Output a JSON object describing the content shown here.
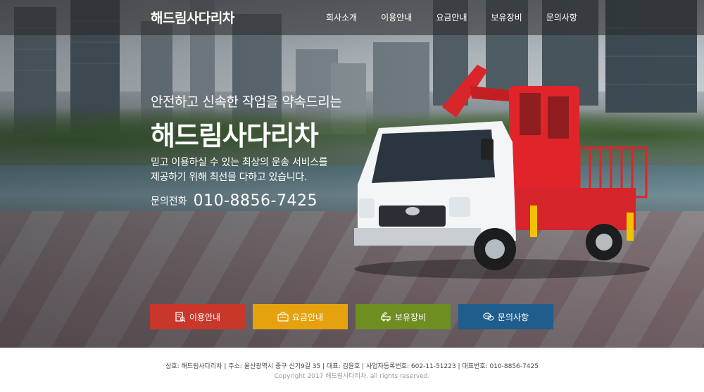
{
  "header": {
    "logo": "해드림사다리차",
    "nav": [
      {
        "label": "회사소개"
      },
      {
        "label": "이용안내"
      },
      {
        "label": "요금안내"
      },
      {
        "label": "보유장비"
      },
      {
        "label": "문의사항"
      }
    ]
  },
  "hero": {
    "tagline": "안전하고 신속한 작업을 약속드리는",
    "title": "해드림사다리차",
    "desc_line1": "믿고 이용하실 수 있는 최상의 운송 서비스를",
    "desc_line2": "제공하기 위해 최선을 다하고 있습니다.",
    "phone_label": "문의전화",
    "phone_number": "010-8856-7425"
  },
  "quick_buttons": [
    {
      "label": "이용안내",
      "icon": "document-search-icon",
      "color": "#c9362a"
    },
    {
      "label": "요금안내",
      "icon": "calculator-icon",
      "color": "#e6a10f"
    },
    {
      "label": "보유장비",
      "icon": "truck-icon",
      "color": "#6f8e22"
    },
    {
      "label": "문의사항",
      "icon": "chat-bubbles-icon",
      "color": "#1e5d8c"
    }
  ],
  "footer": {
    "info": "상호: 해드림사다리차  |  주소: 울산광역시 중구 신기9길 35  |  대표: 김윤호  |  사업자등록번호: 602-11-51223  |  대표번호: 010-8856-7425",
    "copyright": "Copyright 2017 해드림사다리차. all rights reserved."
  }
}
